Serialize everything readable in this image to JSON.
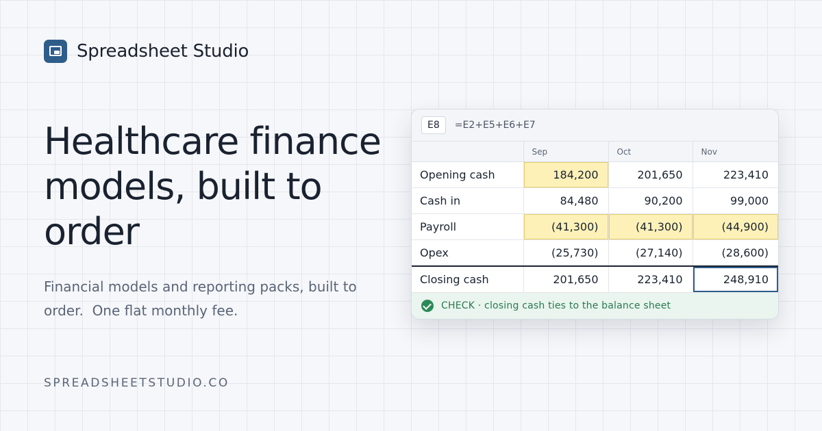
{
  "brand": {
    "name": "Spreadsheet Studio",
    "logo_icon": "spreadsheet-window-icon",
    "color": "#2f5d8a"
  },
  "hero": {
    "headline": "Healthcare finance models, built to order",
    "subtitle": "Financial models and reporting packs, built to order.  One flat monthly fee.",
    "domain": "SPREADSHEETSTUDIO.CO"
  },
  "sheet": {
    "cell_ref": "E8",
    "formula": "=E2+E5+E6+E7",
    "columns": [
      "",
      "Sep",
      "Oct",
      "Nov"
    ],
    "rows": [
      {
        "label": "Opening cash",
        "values": [
          "184,200",
          "201,650",
          "223,410"
        ]
      },
      {
        "label": "Cash in",
        "values": [
          "84,480",
          "90,200",
          "99,000"
        ]
      },
      {
        "label": "Payroll",
        "values": [
          "(41,300)",
          "(41,300)",
          "(44,900)"
        ]
      },
      {
        "label": "Opex",
        "values": [
          "(25,730)",
          "(27,140)",
          "(28,600)"
        ]
      },
      {
        "label": "Closing cash",
        "values": [
          "201,650",
          "223,410",
          "248,910"
        ]
      }
    ],
    "check_text": "CHECK · closing cash ties to the balance sheet",
    "check_icon": "check-circle-icon",
    "highlight_color": "#fdf1b8",
    "check_color": "#2b8a58"
  }
}
